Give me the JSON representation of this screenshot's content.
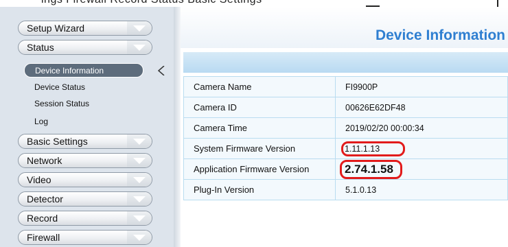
{
  "top_fragment": "ings      Firewall      Record      Status      Basic Settings",
  "sidebar": {
    "sections": [
      {
        "label": "Setup Wizard"
      },
      {
        "label": "Status"
      },
      {
        "label": "Basic Settings"
      },
      {
        "label": "Network"
      },
      {
        "label": "Video"
      },
      {
        "label": "Detector"
      },
      {
        "label": "Record"
      },
      {
        "label": "Firewall"
      }
    ],
    "status_items": [
      {
        "label": "Device Information",
        "active": true
      },
      {
        "label": "Device Status"
      },
      {
        "label": "Session Status"
      },
      {
        "label": "Log"
      }
    ]
  },
  "main": {
    "title": "Device Information",
    "rows": [
      {
        "label": "Camera Name",
        "value": "FI9900P"
      },
      {
        "label": "Camera ID",
        "value": "00626E62DF48"
      },
      {
        "label": "Camera Time",
        "value": "2019/02/20 00:00:34"
      },
      {
        "label": "System Firmware Version",
        "value": "1.11.1.13"
      },
      {
        "label": "Application Firmware Version",
        "value": "2.74.1.58"
      },
      {
        "label": "Plug-In Version",
        "value": "5.1.0.13"
      }
    ]
  },
  "colors": {
    "accent": "#2f7fd1",
    "highlight": "#e21b1b",
    "sidebar_bg": "#dde4ec",
    "active_item_bg": "#5d6c7c"
  }
}
